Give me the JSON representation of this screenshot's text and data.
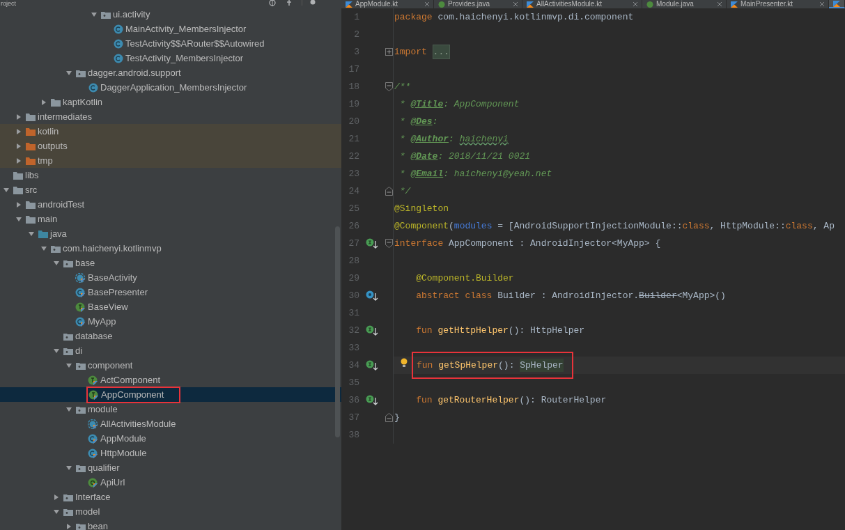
{
  "project_panel": {
    "title": "roject",
    "tree": [
      {
        "children": [
          {
            "children": [
              {
                "children": [
                  {
                    "children": [
                      {
                        "children": [
                          {
                            "children": [
                              {
                                "children": [
                                  {
                                    "label": "ui.activity",
                                    "kind": "package",
                                    "expanded": true,
                                    "selected": false,
                                    "excluded": false,
                                    "children": [
                                      {
                                        "label": "MainActivity_MembersInjector",
                                        "kind": "java-class",
                                        "selected": false,
                                        "excluded": false
                                      },
                                      {
                                        "label": "TestActivity$$ARouter$$Autowired",
                                        "kind": "java-class",
                                        "selected": false,
                                        "excluded": false
                                      },
                                      {
                                        "label": "TestActivity_MembersInjector",
                                        "kind": "java-class",
                                        "selected": false,
                                        "excluded": false
                                      }
                                    ]
                                  }
                                ]
                              }
                            ]
                          },
                          {
                            "label": "dagger.android.support",
                            "kind": "package",
                            "expanded": true,
                            "selected": false,
                            "excluded": false,
                            "children": [
                              {
                                "label": "DaggerApplication_MembersInjector",
                                "kind": "java-class",
                                "selected": false,
                                "excluded": false
                              }
                            ]
                          }
                        ]
                      }
                    ]
                  },
                  {
                    "label": "kaptKotlin",
                    "kind": "folder",
                    "expanded": false,
                    "selected": false,
                    "excluded": false
                  }
                ]
              }
            ]
          },
          {
            "label": "intermediates",
            "kind": "folder",
            "expanded": false,
            "selected": false,
            "excluded": false
          },
          {
            "label": "kotlin",
            "kind": "folder",
            "expanded": false,
            "selected": false,
            "excluded": true
          },
          {
            "label": "outputs",
            "kind": "folder",
            "expanded": false,
            "selected": false,
            "excluded": true
          },
          {
            "label": "tmp",
            "kind": "folder",
            "expanded": false,
            "selected": false,
            "excluded": true
          }
        ]
      },
      {
        "label": "libs",
        "kind": "folder",
        "selected": false,
        "excluded": false
      },
      {
        "label": "src",
        "kind": "folder",
        "expanded": true,
        "selected": false,
        "excluded": false,
        "children": [
          {
            "label": "androidTest",
            "kind": "folder",
            "expanded": false,
            "selected": false,
            "excluded": false
          },
          {
            "label": "main",
            "kind": "folder",
            "expanded": true,
            "selected": false,
            "excluded": false,
            "children": [
              {
                "label": "java",
                "kind": "source-folder",
                "expanded": true,
                "selected": false,
                "excluded": false,
                "children": [
                  {
                    "label": "com.haichenyi.kotlinmvp",
                    "kind": "package",
                    "expanded": true,
                    "selected": false,
                    "excluded": false,
                    "children": [
                      {
                        "label": "base",
                        "kind": "package",
                        "expanded": true,
                        "selected": false,
                        "excluded": false,
                        "children": [
                          {
                            "label": "BaseActivity",
                            "kind": "kotlin-abstract",
                            "selected": false,
                            "excluded": false
                          },
                          {
                            "label": "BasePresenter",
                            "kind": "kotlin-class",
                            "selected": false,
                            "excluded": false
                          },
                          {
                            "label": "BaseView",
                            "kind": "kotlin-interface",
                            "selected": false,
                            "excluded": false
                          },
                          {
                            "label": "MyApp",
                            "kind": "kotlin-class",
                            "selected": false,
                            "excluded": false
                          }
                        ]
                      },
                      {
                        "label": "database",
                        "kind": "package",
                        "selected": false,
                        "excluded": false
                      },
                      {
                        "label": "di",
                        "kind": "package",
                        "expanded": true,
                        "selected": false,
                        "excluded": false,
                        "children": [
                          {
                            "label": "component",
                            "kind": "package",
                            "expanded": true,
                            "selected": false,
                            "excluded": false,
                            "children": [
                              {
                                "label": "ActComponent",
                                "kind": "kotlin-interface",
                                "selected": false,
                                "excluded": false
                              },
                              {
                                "label": "AppComponent",
                                "kind": "kotlin-interface",
                                "selected": true,
                                "excluded": false,
                                "framed": true
                              }
                            ]
                          },
                          {
                            "label": "module",
                            "kind": "package",
                            "expanded": true,
                            "selected": false,
                            "excluded": false,
                            "children": [
                              {
                                "label": "AllActivitiesModule",
                                "kind": "kotlin-abstract",
                                "selected": false,
                                "excluded": false
                              },
                              {
                                "label": "AppModule",
                                "kind": "kotlin-class",
                                "selected": false,
                                "excluded": false
                              },
                              {
                                "label": "HttpModule",
                                "kind": "kotlin-class",
                                "selected": false,
                                "excluded": false
                              }
                            ]
                          },
                          {
                            "label": "qualifier",
                            "kind": "package",
                            "expanded": true,
                            "selected": false,
                            "excluded": false,
                            "children": [
                              {
                                "label": "ApiUrl",
                                "kind": "kotlin-annotation",
                                "selected": false,
                                "excluded": false
                              }
                            ]
                          }
                        ]
                      },
                      {
                        "label": "Interface",
                        "kind": "package",
                        "expanded": false,
                        "selected": false,
                        "excluded": false
                      },
                      {
                        "label": "model",
                        "kind": "package",
                        "expanded": true,
                        "selected": false,
                        "excluded": false,
                        "children": [
                          {
                            "label": "bean",
                            "kind": "package",
                            "expanded": false,
                            "selected": false,
                            "excluded": false
                          }
                        ]
                      }
                    ]
                  }
                ]
              }
            ]
          }
        ]
      }
    ]
  },
  "editor": {
    "tabs": [
      {
        "label": "AppModule.kt",
        "kind": "kotlin",
        "selected": false
      },
      {
        "label": "Provides.java",
        "kind": "java",
        "selected": false
      },
      {
        "label": "AllActivitiesModule.kt",
        "kind": "kotlin",
        "selected": false
      },
      {
        "label": "Module.java",
        "kind": "java",
        "selected": false
      },
      {
        "label": "MainPresenter.kt",
        "kind": "kotlin",
        "selected": false
      },
      {
        "kind": "kotlin",
        "selected": true
      }
    ],
    "lines": [
      {
        "number": "1",
        "tokens": [
          {
            "kind": "keyword",
            "text": "package"
          },
          {
            "kind": "plain",
            "text": " com.haichenyi.kotlinmvp.di.component"
          }
        ]
      },
      {
        "number": "2"
      },
      {
        "number": "3",
        "folded": true,
        "tokens": [
          {
            "kind": "keyword",
            "text": "import "
          },
          {
            "kind": "folded",
            "text": "..."
          }
        ]
      },
      {
        "number": "17"
      },
      {
        "number": "18",
        "fold_start": true,
        "tokens": [
          {
            "kind": "comment",
            "text": "/**"
          }
        ]
      },
      {
        "number": "19",
        "tokens": [
          {
            "kind": "comment",
            "text": " * "
          },
          {
            "kind": "doctag",
            "text": "@Title"
          },
          {
            "kind": "comment",
            "text": ": AppComponent"
          }
        ]
      },
      {
        "number": "20",
        "tokens": [
          {
            "kind": "comment",
            "text": " * "
          },
          {
            "kind": "doctag",
            "text": "@Des"
          },
          {
            "kind": "comment",
            "text": ":"
          }
        ]
      },
      {
        "number": "21",
        "tokens": [
          {
            "kind": "comment",
            "text": " * "
          },
          {
            "kind": "doctag",
            "text": "@Author"
          },
          {
            "kind": "comment",
            "text": ": "
          },
          {
            "kind": "typo",
            "text": "haichenyi"
          }
        ]
      },
      {
        "number": "22",
        "tokens": [
          {
            "kind": "comment",
            "text": " * "
          },
          {
            "kind": "doctag",
            "text": "@Date"
          },
          {
            "kind": "comment",
            "text": ": 2018/11/21 0021"
          }
        ]
      },
      {
        "number": "23",
        "tokens": [
          {
            "kind": "comment",
            "text": " * "
          },
          {
            "kind": "doctag",
            "text": "@Email"
          },
          {
            "kind": "comment",
            "text": ": haichenyi@yeah.net"
          }
        ]
      },
      {
        "number": "24",
        "fold_end": true,
        "tokens": [
          {
            "kind": "comment",
            "text": " */"
          }
        ]
      },
      {
        "number": "25",
        "tokens": [
          {
            "kind": "annotation",
            "text": "@Singleton"
          }
        ]
      },
      {
        "number": "26",
        "tokens": [
          {
            "kind": "annotation",
            "text": "@Component"
          },
          {
            "kind": "plain",
            "text": "("
          },
          {
            "kind": "named-arg",
            "text": "modules"
          },
          {
            "kind": "plain",
            "text": " = [AndroidSupportInjectionModule::"
          },
          {
            "kind": "keyword",
            "text": "class"
          },
          {
            "kind": "plain",
            "text": ", HttpModule::"
          },
          {
            "kind": "keyword",
            "text": "class"
          },
          {
            "kind": "plain",
            "text": ", Ap"
          }
        ]
      },
      {
        "number": "27",
        "implemented": true,
        "fold_start": true,
        "tokens": [
          {
            "kind": "keyword",
            "text": "interface"
          },
          {
            "kind": "plain",
            "text": " AppComponent : AndroidInjector<MyApp> {"
          }
        ]
      },
      {
        "number": "28"
      },
      {
        "number": "29",
        "tokens": [
          {
            "kind": "annotation",
            "text": "    @Component.Builder"
          }
        ]
      },
      {
        "number": "30",
        "overridden": true,
        "tokens": [
          {
            "kind": "keyword",
            "text": "    abstract class"
          },
          {
            "kind": "plain",
            "text": " Builder : AndroidInjector."
          },
          {
            "kind": "deprecated",
            "text": "Builder"
          },
          {
            "kind": "plain",
            "text": "<MyApp>()"
          }
        ]
      },
      {
        "number": "31"
      },
      {
        "number": "32",
        "implemented": true,
        "tokens": [
          {
            "kind": "keyword",
            "text": "    fun"
          },
          {
            "kind": "function",
            "text": " getHttpHelper"
          },
          {
            "kind": "plain",
            "text": "(): HttpHelper"
          }
        ]
      },
      {
        "number": "33"
      },
      {
        "number": "34",
        "indented": true,
        "implemented": true,
        "intention": true,
        "current": true,
        "framed": true,
        "tokens": [
          {
            "kind": "keyword",
            "text": "fun"
          },
          {
            "kind": "function",
            "text": " getSpHelper"
          },
          {
            "kind": "plain",
            "text": "(): "
          },
          {
            "kind": "usage",
            "text": "SpHelper"
          }
        ]
      },
      {
        "number": "35"
      },
      {
        "number": "36",
        "implemented": true,
        "tokens": [
          {
            "kind": "keyword",
            "text": "    fun"
          },
          {
            "kind": "function",
            "text": " getRouterHelper"
          },
          {
            "kind": "plain",
            "text": "(): RouterHelper"
          }
        ]
      },
      {
        "number": "37",
        "fold_end": true,
        "tokens": [
          {
            "kind": "plain",
            "text": "}"
          }
        ]
      },
      {
        "number": "38"
      }
    ]
  }
}
